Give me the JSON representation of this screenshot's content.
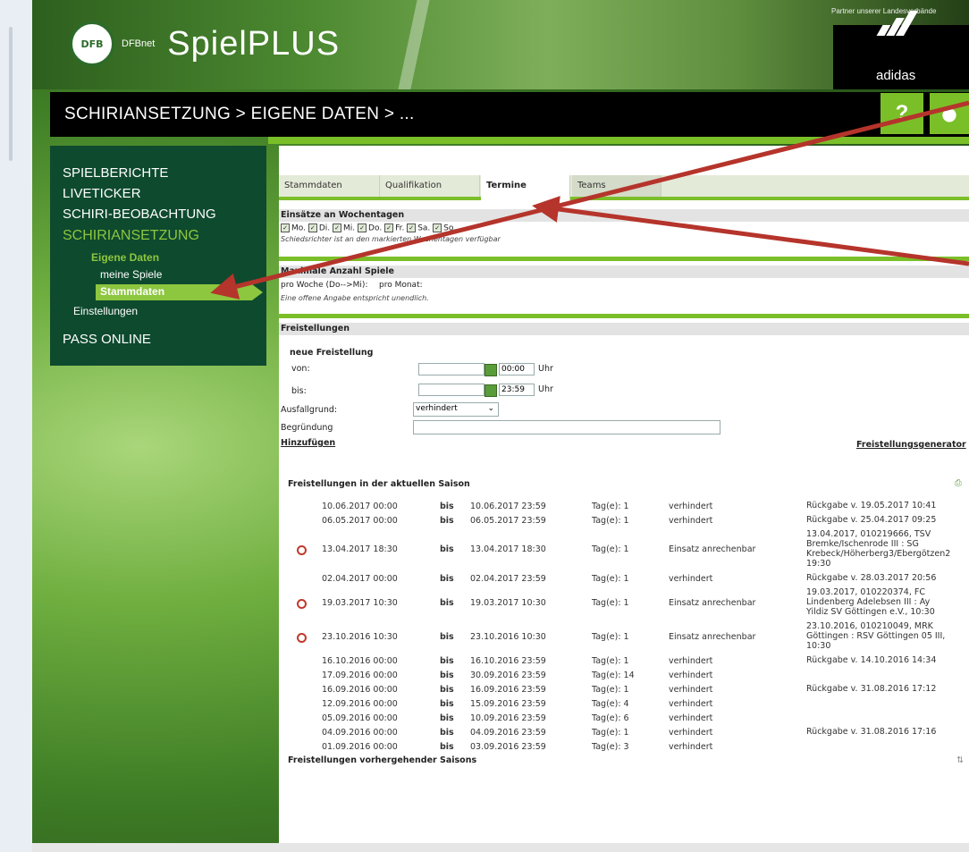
{
  "header": {
    "brand_small": "DFBnet",
    "brand": "SpielPLUS",
    "partner_text": "Partner unserer Landesverbände",
    "sponsor": "adidas"
  },
  "breadcrumb": "SCHIRIANSETZUNG > EIGENE DATEN > ...",
  "help_label": "?",
  "nav": {
    "spielberichte": "SPIELBERICHTE",
    "liveticker": "LIVETICKER",
    "beobachtung": "SCHIRI-BEOBACHTUNG",
    "ansetzung": "SCHIRIANSETZUNG",
    "eigene_daten": "Eigene Daten",
    "meine_spiele": "meine Spiele",
    "stammdaten": "Stammdaten",
    "einstellungen": "Einstellungen",
    "pass_online": "PASS ONLINE"
  },
  "tabs": [
    "Stammdaten",
    "Qualifikation",
    "Termine",
    "Teams"
  ],
  "weekdays_section": {
    "title": "Einsätze an Wochentagen",
    "days": [
      "Mo.",
      "Di.",
      "Mi.",
      "Do.",
      "Fr.",
      "Sa.",
      "So."
    ],
    "note": "Schiedsrichter ist an den markierten Wochentagen verfügbar"
  },
  "max_section": {
    "title": "Maximale Anzahl Spiele",
    "week_label": "pro Woche (Do-->Mi):",
    "month_label": "pro Monat:",
    "note": "Eine offene Angabe entspricht unendlich."
  },
  "freistellungen": {
    "title": "Freistellungen",
    "new_title": "neue Freistellung",
    "von_label": "von:",
    "von_time": "00:00",
    "bis_label": "bis:",
    "bis_time": "23:59",
    "uhr": "Uhr",
    "grund_label": "Ausfallgrund:",
    "grund_value": "verhindert",
    "begruendung_label": "Begründung",
    "add_link": "Hinzufügen",
    "generator_link": "Freistellungsgenerator"
  },
  "current_title": "Freistellungen in der aktuellen Saison",
  "previous_title": "Freistellungen vorhergehender Saisons",
  "rows": [
    {
      "from": "10.06.2017 00:00",
      "bis": "bis",
      "to": "10.06.2017 23:59",
      "days": "Tag(e): 1",
      "reason": "verhindert",
      "info": [
        "Rückgabe v. 19.05.2017 10:41"
      ],
      "icon": false
    },
    {
      "from": "06.05.2017 00:00",
      "bis": "bis",
      "to": "06.05.2017 23:59",
      "days": "Tag(e): 1",
      "reason": "verhindert",
      "info": [
        "Rückgabe v. 25.04.2017 09:25"
      ],
      "icon": false
    },
    {
      "from": "13.04.2017 18:30",
      "bis": "bis",
      "to": "13.04.2017 18:30",
      "days": "Tag(e): 1",
      "reason": "Einsatz anrechenbar",
      "info": [
        "13.04.2017, 010219666, TSV",
        "Bremke/Ischenrode III : SG",
        "Krebeck/Höherberg3/Ebergötzen2",
        "19:30"
      ],
      "icon": true
    },
    {
      "from": "02.04.2017 00:00",
      "bis": "bis",
      "to": "02.04.2017 23:59",
      "days": "Tag(e): 1",
      "reason": "verhindert",
      "info": [
        "Rückgabe v. 28.03.2017 20:56"
      ],
      "icon": false
    },
    {
      "from": "19.03.2017 10:30",
      "bis": "bis",
      "to": "19.03.2017 10:30",
      "days": "Tag(e): 1",
      "reason": "Einsatz anrechenbar",
      "info": [
        "19.03.2017, 010220374, FC",
        "Lindenberg Adelebsen III : Ay",
        "Yildiz SV Göttingen e.V., 10:30"
      ],
      "icon": true
    },
    {
      "from": "23.10.2016 10:30",
      "bis": "bis",
      "to": "23.10.2016 10:30",
      "days": "Tag(e): 1",
      "reason": "Einsatz anrechenbar",
      "info": [
        "23.10.2016, 010210049, MRK",
        "Göttingen : RSV Göttingen 05 III,",
        "10:30"
      ],
      "icon": true
    },
    {
      "from": "16.10.2016 00:00",
      "bis": "bis",
      "to": "16.10.2016 23:59",
      "days": "Tag(e): 1",
      "reason": "verhindert",
      "info": [
        "Rückgabe v. 14.10.2016 14:34"
      ],
      "icon": false
    },
    {
      "from": "17.09.2016 00:00",
      "bis": "bis",
      "to": "30.09.2016 23:59",
      "days": "Tag(e): 14",
      "reason": "verhindert",
      "info": [],
      "icon": false
    },
    {
      "from": "16.09.2016 00:00",
      "bis": "bis",
      "to": "16.09.2016 23:59",
      "days": "Tag(e): 1",
      "reason": "verhindert",
      "info": [
        "Rückgabe v. 31.08.2016 17:12"
      ],
      "icon": false
    },
    {
      "from": "12.09.2016 00:00",
      "bis": "bis",
      "to": "15.09.2016 23:59",
      "days": "Tag(e): 4",
      "reason": "verhindert",
      "info": [],
      "icon": false
    },
    {
      "from": "05.09.2016 00:00",
      "bis": "bis",
      "to": "10.09.2016 23:59",
      "days": "Tag(e): 6",
      "reason": "verhindert",
      "info": [],
      "icon": false
    },
    {
      "from": "04.09.2016 00:00",
      "bis": "bis",
      "to": "04.09.2016 23:59",
      "days": "Tag(e): 1",
      "reason": "verhindert",
      "info": [
        "Rückgabe v. 31.08.2016 17:16"
      ],
      "icon": false
    },
    {
      "from": "01.09.2016 00:00",
      "bis": "bis",
      "to": "03.09.2016 23:59",
      "days": "Tag(e): 3",
      "reason": "verhindert",
      "info": [],
      "icon": false
    }
  ],
  "colors": {
    "accent": "#7bbf28",
    "nav_bg": "#0e4a2e",
    "nav_active": "#8dc63f",
    "arrow": "#b5342b"
  }
}
